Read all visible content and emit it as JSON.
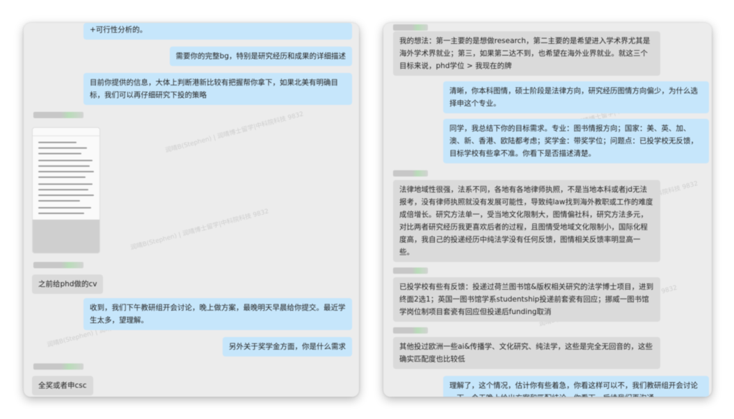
{
  "left_panel": {
    "messages": [
      {
        "side": "me",
        "text": "+可行性分析的。"
      },
      {
        "side": "me",
        "text": "需要你的完整bg，特别是研究经历和成果的详细描述"
      },
      {
        "side": "me",
        "text": "目前你提供的信息，大体上判断港新比较有把握帮你拿下，如果北美有明确目标，我们可以再仔细研究下投的策略"
      },
      {
        "side": "them",
        "text": "之前给phd做的cv"
      },
      {
        "side": "me",
        "text": "收到，我们下午教研组开会讨论，晚上做方案，最晚明天早晨给你提交。最近学生太多，望理解。"
      },
      {
        "side": "me",
        "text": "另外关于奖学金方面，你是什么需求"
      },
      {
        "side": "them",
        "text": "全奖或者申csc"
      }
    ],
    "watermark": "润晴B(Stephen) | 润晴博士留学|中科院科技 9832"
  },
  "right_panel": {
    "messages": [
      {
        "side": "them",
        "text": "我的想法：第一主要的是想做research，第二主要的是希望进入学术界尤其是海外学术界就业；第三，如果第二达不到，也希望在海外业界就业。就这三个目标来说，phd学位 > 我现在的牌"
      },
      {
        "side": "me",
        "text": "清晰，你本科图情，硕士阶段是法律方向，研究经历图情方向偏少，为什么选择申这个专业。"
      },
      {
        "side": "me",
        "text": "同学，我总结下你的目标需求。专业：图书情报方向；国家：美、英、加、澳、新、香港、欧陆都考虑；奖学金：带奖学位；问题点：已投学校无反馈，目标学校有些拿不准。你看下是否描述清楚。"
      },
      {
        "side": "them",
        "text": "法律地域性很强，法系不同，各地有各地律师执照，不是当地本科或者jd无法报考，没有律师执照就没有发展可能性，导致纯law找到海外教职或工作的难度成倍增长。研究方法单一，受当地文化限制大，图情偏社科，研究方法多元，对比两者研究经历我更喜欢后者的过程，且图情受地域文化限制小，国际化程度高，我自己的投递经历中纯法学没有任何反馈，图情相关反馈率明显高一些。"
      },
      {
        "side": "them",
        "text": "已投学校有些有反馈：投递过荷兰图书馆&版权相关研究的法学博士项目，进到终面2选1；英国一图书馆学系studentship投递前套瓷有回应；挪威一图书馆学岗位制项目套瓷有回应但投递后funding取消"
      },
      {
        "side": "them",
        "text": "其他投过欧洲一些ai&传播学、文化研究、纯法学，这些是完全无回音的，这些确实匹配度也比较低"
      },
      {
        "side": "me",
        "text": "理解了，这个情况，估计你有些着急，你看这样可以不，我们教研组开会讨论一下，今天晚上给出方案和匹配结论，你看下，后续我们再沟通"
      }
    ],
    "watermark": "润晴B(Stephen) | 润晴博士留学|中科院科技 9832"
  }
}
